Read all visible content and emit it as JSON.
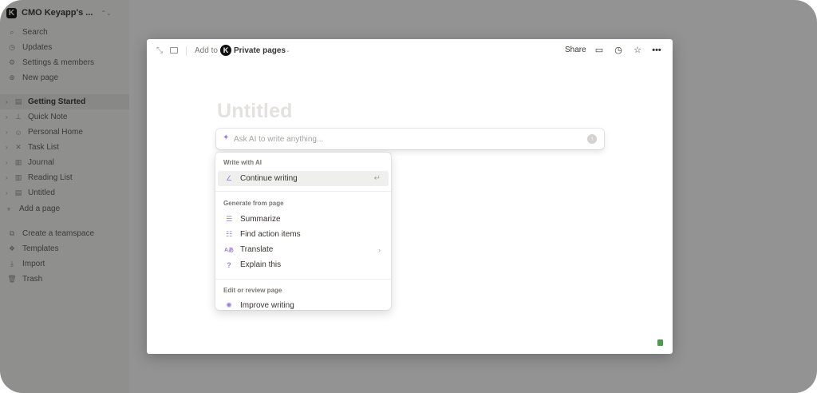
{
  "sidebar": {
    "workspace_name": "CMO Keyapp's ...",
    "workspace_initial": "K",
    "nav": [
      {
        "label": "Search",
        "icon": "search-icon"
      },
      {
        "label": "Updates",
        "icon": "updates-icon"
      },
      {
        "label": "Settings & members",
        "icon": "gear-icon"
      },
      {
        "label": "New page",
        "icon": "plus-circle-icon"
      }
    ],
    "pages": [
      {
        "label": "Getting Started",
        "icon": "page-icon",
        "active": true
      },
      {
        "label": "Quick Note",
        "icon": "pin-icon"
      },
      {
        "label": "Personal Home",
        "icon": "person-icon"
      },
      {
        "label": "Task List",
        "icon": "tasks-icon"
      },
      {
        "label": "Journal",
        "icon": "book-icon"
      },
      {
        "label": "Reading List",
        "icon": "book-icon"
      },
      {
        "label": "Untitled",
        "icon": "page-icon"
      }
    ],
    "add_page": "Add a page",
    "bottom": [
      {
        "label": "Create a teamspace",
        "icon": "teamspace-icon"
      },
      {
        "label": "Templates",
        "icon": "templates-icon"
      },
      {
        "label": "Import",
        "icon": "import-icon"
      },
      {
        "label": "Trash",
        "icon": "trash-icon"
      }
    ]
  },
  "modal": {
    "add_to": "Add to",
    "avatar_initial": "K",
    "location": "Private pages",
    "share": "Share",
    "title_placeholder": "Untitled",
    "ai_placeholder": "Ask AI to write anything...",
    "menu": {
      "section_write": "Write with AI",
      "continue_writing": "Continue writing",
      "section_generate": "Generate from page",
      "summarize": "Summarize",
      "find_action_items": "Find action items",
      "translate": "Translate",
      "explain_this": "Explain this",
      "section_edit": "Edit or review page",
      "improve_writing": "Improve writing"
    }
  },
  "colors": {
    "ai_accent": "#9b7fd4",
    "overlay": "rgba(15,15,15,0.45)",
    "help_badge": "#4e9a53"
  }
}
